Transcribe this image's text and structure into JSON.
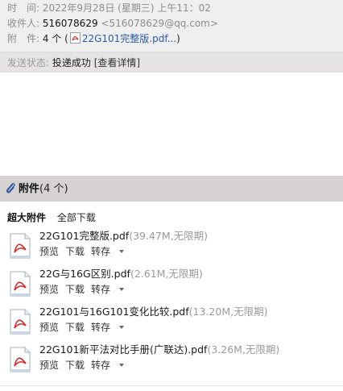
{
  "header": {
    "time_label": "时　间:",
    "time_value": "2022年9月28日 (星期三) 上午11：02",
    "to_label": "收件人:",
    "to_name": "516078629",
    "to_email": "<516078629@qq.com>",
    "attach_label": "附　件:",
    "attach_count": "4 个 (",
    "attach_ref": "22G101完整版.pdf...",
    "attach_close": ")"
  },
  "status": {
    "label": "发送状态:",
    "value": "投递成功",
    "details": "[查看详情]"
  },
  "attachments_bar": {
    "title": "附件",
    "count": "(4 个)"
  },
  "attachments_toolbar": {
    "big_label": "超大附件",
    "download_all": "全部下载"
  },
  "attachments": [
    {
      "name": "22G101完整版.pdf",
      "meta": "(39.47M,无限期)",
      "preview": "预览",
      "download": "下载",
      "save": "转存"
    },
    {
      "name": "22G与16G区别.pdf",
      "meta": "(2.61M,无限期)",
      "preview": "预览",
      "download": "下载",
      "save": "转存"
    },
    {
      "name": "22G101与16G101变化比较.pdf",
      "meta": "(13.20M,无限期)",
      "preview": "预览",
      "download": "下载",
      "save": "转存"
    },
    {
      "name": "22G101新平法对比手册(广联达).pdf",
      "meta": "(3.26M,无限期)",
      "preview": "预览",
      "download": "下载",
      "save": "转存"
    }
  ],
  "icons": {
    "file": "pdf-file-icon",
    "attach": "paperclip-icon"
  }
}
